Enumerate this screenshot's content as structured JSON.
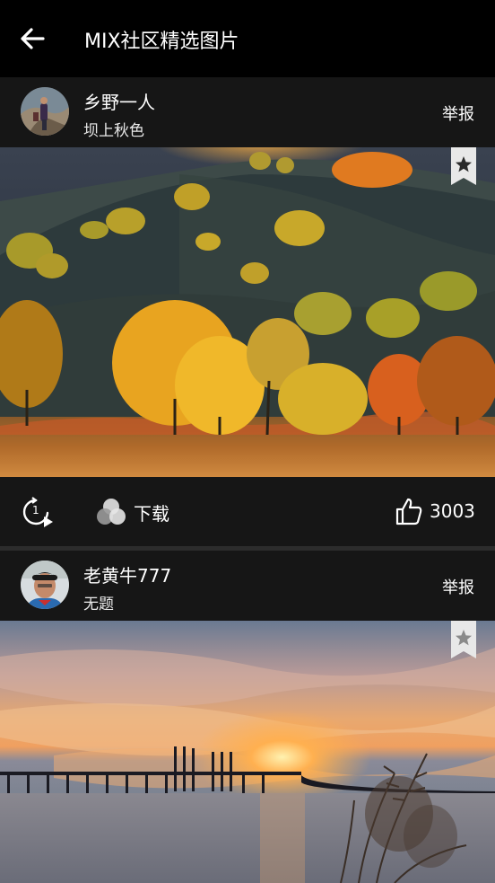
{
  "header": {
    "title": "MIX社区精选图片"
  },
  "posts": [
    {
      "user": "乡野一人",
      "subtitle": "坝上秋色",
      "report_label": "举报",
      "download_label": "下载",
      "likes": "3003"
    },
    {
      "user": "老黄牛777",
      "subtitle": "无题",
      "report_label": "举报"
    }
  ],
  "colors": {
    "background": "#000000",
    "card": "#161616",
    "text": "#ffffff"
  }
}
